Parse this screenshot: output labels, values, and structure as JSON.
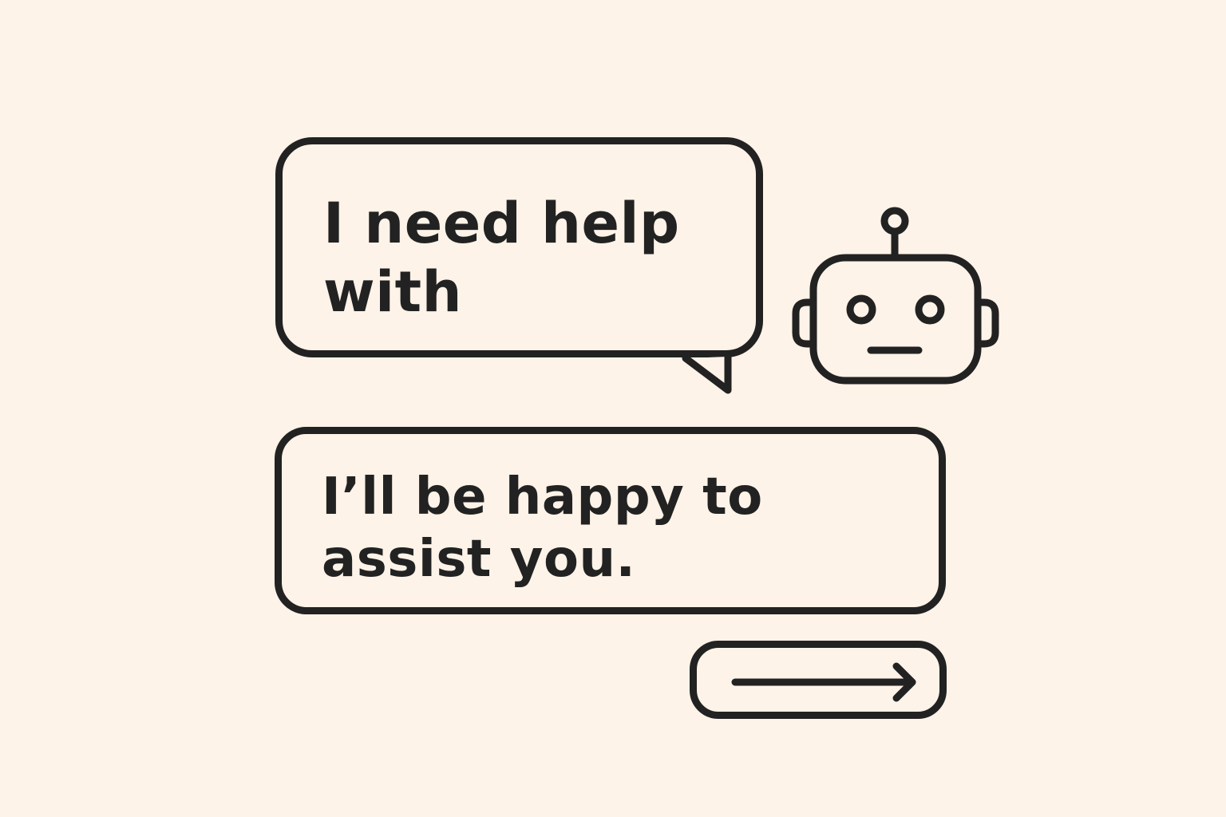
{
  "conversation": {
    "user_message": "I need help with",
    "assistant_message": "I’ll be happy to assist you."
  },
  "avatar": {
    "icon": "robot-icon"
  },
  "send_button": {
    "icon": "arrow-right-icon"
  },
  "colors": {
    "background": "#fdf3e8",
    "ink": "#222222"
  }
}
